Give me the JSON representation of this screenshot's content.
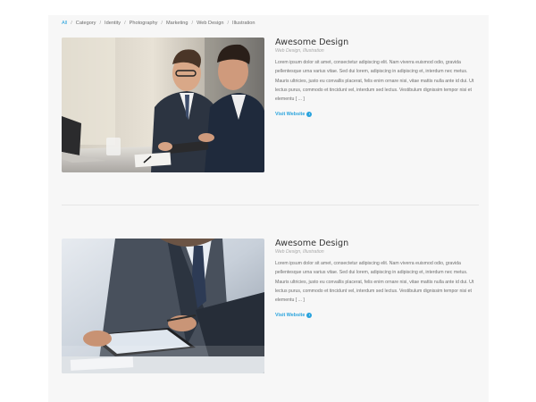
{
  "filters": {
    "items": [
      "All",
      "Category",
      "Identity",
      "Photography",
      "Marketing",
      "Web Design",
      "Illustration"
    ],
    "active_index": 0,
    "separator": "/"
  },
  "colors": {
    "accent": "#29a3dd",
    "panel_bg": "#f7f7f7",
    "title": "#333333",
    "body_text": "#6d6d6d"
  },
  "entries": [
    {
      "image_icon": "business-meeting-photo",
      "title": "Awesome Design",
      "categories": "Web Design, Illustration",
      "description": "Lorem ipsum dolor sit amet, consectetur adipiscing elit. Nam viverra euismod odio, gravida pellentesque urna varius vitae. Sed dui lorem, adipiscing in adipiscing et, interdum nec metus. Mauris ultricies, justo eu convallis placerat, felis enim ornare nisi, vitae mattis nulla ante id dui. Ut lectus purus, commodo et tincidunt vel, interdum sed lectus. Vestibulum dignissim tempor nisi et elementu [ ... ]",
      "link_label": "Visit Website",
      "link_icon": "info-circle-icon"
    },
    {
      "image_icon": "tablet-business-photo",
      "title": "Awesome Design",
      "categories": "Web Design, Illustration",
      "description": "Lorem ipsum dolor sit amet, consectetur adipiscing elit. Nam viverra euismod odio, gravida pellentesque urna varius vitae. Sed dui lorem, adipiscing in adipiscing et, interdum nec metus. Mauris ultricies, justo eu convallis placerat, felis enim ornare nisi, vitae mattis nulla ante id dui. Ut lectus purus, commodo et tincidunt vel, interdum sed lectus. Vestibulum dignissim tempor nisi et elementu [ ... ]",
      "link_label": "Visit Website",
      "link_icon": "info-circle-icon"
    }
  ]
}
